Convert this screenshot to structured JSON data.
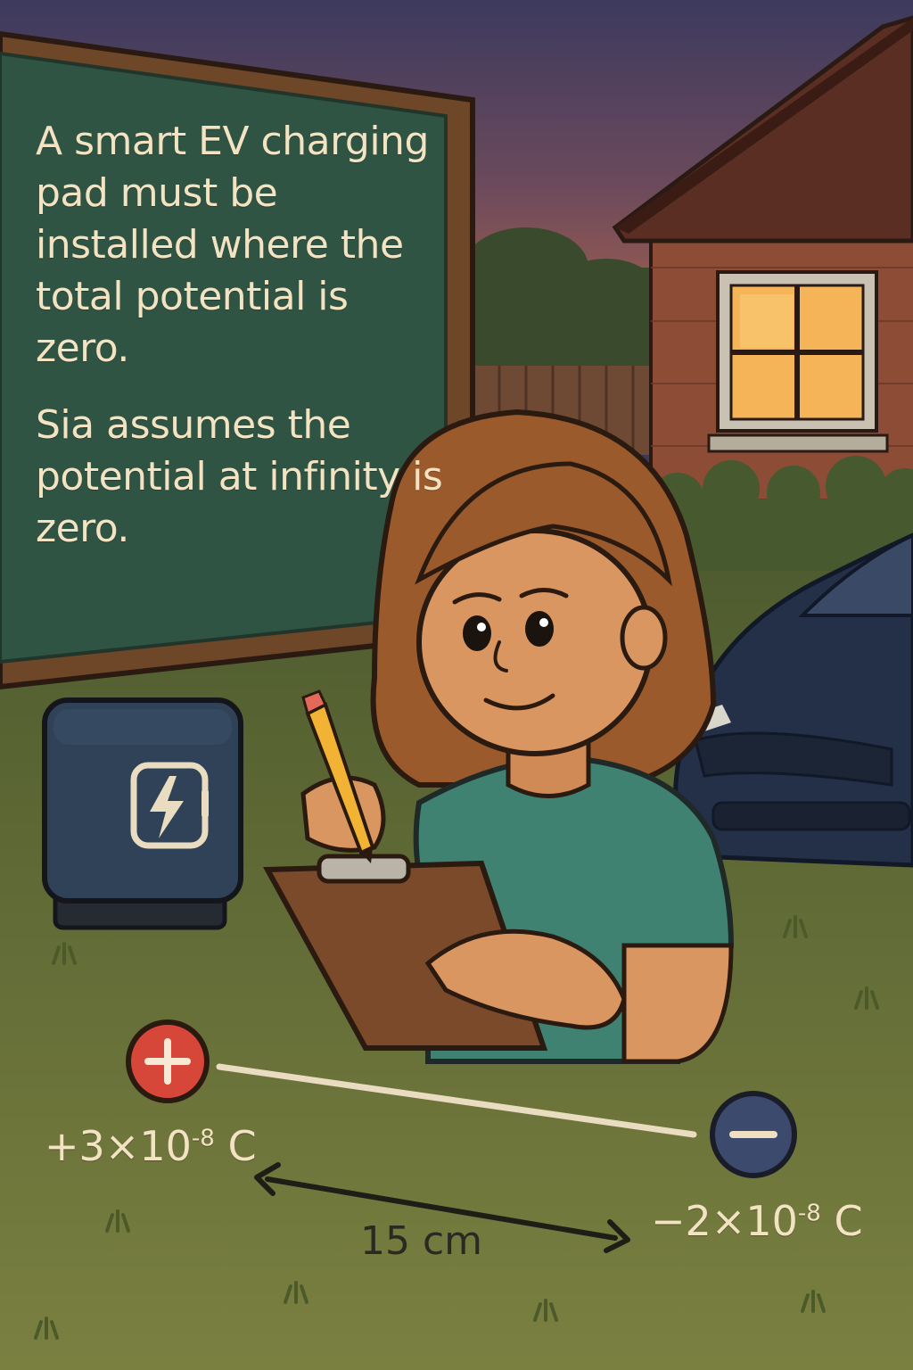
{
  "board": {
    "text_1": "A smart EV charging pad must be installed where the total potential is zero.",
    "text_2": "Sia assumes the potential at infinity is zero."
  },
  "charges": {
    "positive": {
      "sign": "+",
      "label": "+3×10-8 C",
      "color": "#d6473a"
    },
    "negative": {
      "sign": "−",
      "label": "−2×10-8 C",
      "color": "#3c4a6e"
    }
  },
  "distance": {
    "label": "15 cm"
  },
  "colors": {
    "sky_top": "#3d3a5e",
    "sky_bottom": "#c46a46",
    "board": "#2f5443",
    "grass": "#6f7a3a",
    "shirt": "#3f8272",
    "hair": "#9a5a2c"
  },
  "icons": {
    "charger": "lightning-bolt-icon",
    "pencil": "pencil-icon",
    "clipboard": "clipboard-icon"
  }
}
